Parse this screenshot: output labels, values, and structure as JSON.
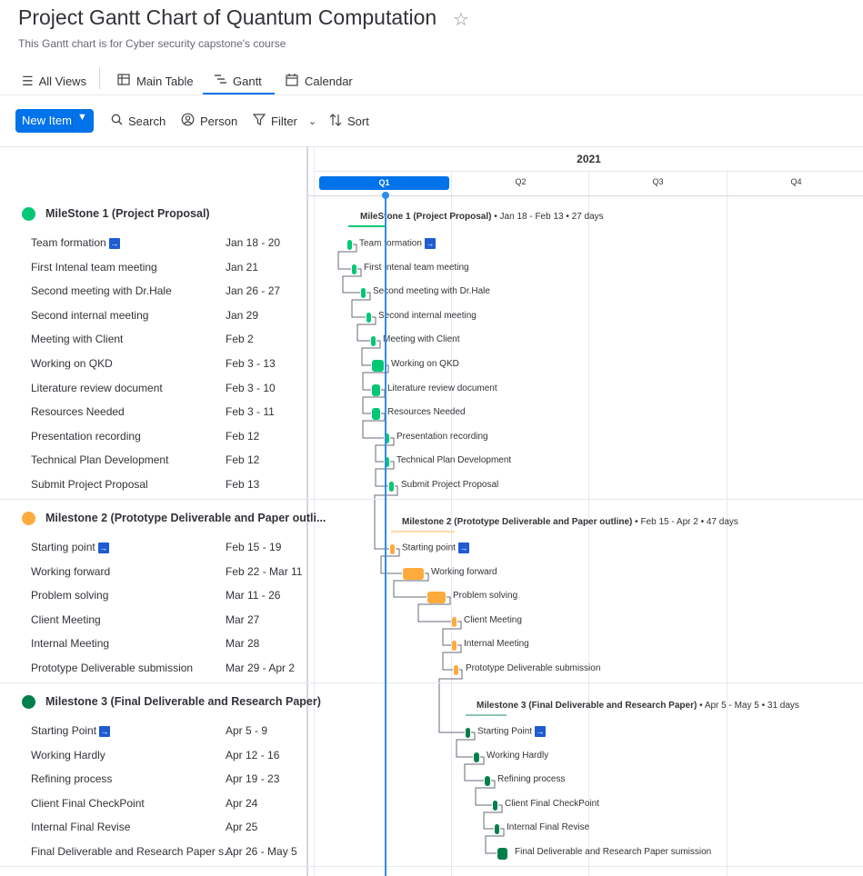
{
  "header": {
    "title": "Project Gantt Chart of Quantum Computation",
    "subtitle": "This Gantt chart is for Cyber security capstone's course"
  },
  "views": {
    "all_views": "All Views",
    "main_table": "Main Table",
    "gantt": "Gantt",
    "calendar": "Calendar"
  },
  "toolbar": {
    "new_item": "New Item",
    "search": "Search",
    "person": "Person",
    "filter": "Filter",
    "sort": "Sort"
  },
  "timeline": {
    "year": "2021",
    "quarters": [
      "Q1",
      "Q2",
      "Q3",
      "Q4"
    ]
  },
  "colors": {
    "accent": "#0073ea",
    "today": "#2d8de8",
    "group1": "#00c875",
    "group2": "#fdab3d",
    "group3": "#037f4c"
  },
  "groups": [
    {
      "name": "MileStone 1 (Project Proposal)",
      "name_full": "MileStone 1 (Project Proposal)",
      "summary": "Jan 18 - Feb 13 • 27 days",
      "items": [
        {
          "name": "Team formation",
          "date": "Jan 18 - 20",
          "linked": true
        },
        {
          "name": "First Intenal team meeting",
          "date": "Jan 21"
        },
        {
          "name": "Second meeting with Dr.Hale",
          "date": "Jan 26 - 27"
        },
        {
          "name": "Second internal meeting",
          "date": "Jan 29"
        },
        {
          "name": "Meeting with Client",
          "date": "Feb 2"
        },
        {
          "name": "Working on QKD",
          "date": "Feb 3 - 13"
        },
        {
          "name": "Literature review document",
          "date": "Feb 3 - 10"
        },
        {
          "name": "Resources Needed",
          "date": "Feb 3 - 11"
        },
        {
          "name": "Presentation recording",
          "date": "Feb 12"
        },
        {
          "name": "Technical Plan Development",
          "date": "Feb 12"
        },
        {
          "name": "Submit Project Proposal",
          "date": "Feb 13"
        }
      ]
    },
    {
      "name": "Milestone 2 (Prototype Deliverable and Paper outli...",
      "name_full": "Milestone 2 (Prototype Deliverable and Paper outline)",
      "summary": "Feb 15 - Apr 2 • 47 days",
      "items": [
        {
          "name": "Starting point",
          "date": "Feb 15 - 19",
          "linked": true
        },
        {
          "name": "Working forward",
          "date": "Feb 22 - Mar 11"
        },
        {
          "name": "Problem solving",
          "date": "Mar 11 - 26"
        },
        {
          "name": "Client Meeting",
          "date": "Mar 27"
        },
        {
          "name": "Internal Meeting",
          "date": "Mar 28"
        },
        {
          "name": "Prototype Deliverable submission",
          "date": "Mar 29 - Apr 2"
        }
      ]
    },
    {
      "name": "Milestone 3 (Final Deliverable and Research Paper)",
      "name_full": "Milestone 3 (Final Deliverable and Research Paper)",
      "summary": "Apr 5 - May 5 • 31 days",
      "items": [
        {
          "name": "Starting Point",
          "date": "Apr 5 - 9",
          "linked": true
        },
        {
          "name": "Working Hardly",
          "date": "Apr 12 - 16"
        },
        {
          "name": "Refining process",
          "date": "Apr 19 - 23"
        },
        {
          "name": "Client Final CheckPoint",
          "date": "Apr 24"
        },
        {
          "name": "Internal Final Revise",
          "date": "Apr 25"
        },
        {
          "name": "Final Deliverable and Research Paper s...",
          "date": "Apr 26 - May 5",
          "bar_label": "Final Deliverable and Research Paper sumission"
        }
      ]
    }
  ]
}
